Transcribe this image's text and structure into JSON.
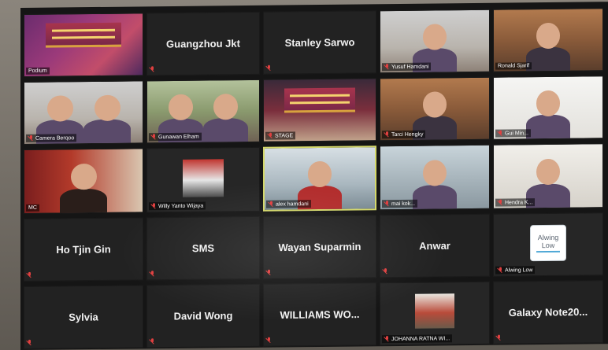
{
  "meeting": {
    "tiles": [
      {
        "name": "Podium",
        "type": "video",
        "scene": "podium"
      },
      {
        "name": "Guangzhou Jkt",
        "type": "name"
      },
      {
        "name": "Stanley Sarwo",
        "type": "name"
      },
      {
        "name": "Yusuf Hamdani",
        "type": "video",
        "scene": "room"
      },
      {
        "name": "Ronald Sjarif",
        "type": "video",
        "scene": "office"
      },
      {
        "name": "Camera Berqoo",
        "type": "video",
        "scene": "room"
      },
      {
        "name": "Gunawan Elham",
        "type": "video",
        "scene": "garden"
      },
      {
        "name": "STAGE",
        "type": "video",
        "scene": "stage"
      },
      {
        "name": "Tarci Hengky",
        "type": "video",
        "scene": "office"
      },
      {
        "name": "Gui Min...",
        "type": "video",
        "scene": "white"
      },
      {
        "name": "MC",
        "type": "video",
        "scene": "mc"
      },
      {
        "name": "Willy Yanto Wijaya",
        "type": "video",
        "scene": "dark"
      },
      {
        "name": "alex hamdani",
        "type": "video",
        "scene": "window",
        "active": true
      },
      {
        "name": "mai kok...",
        "type": "video",
        "scene": "car"
      },
      {
        "name": "Hendra K...",
        "type": "video",
        "scene": "light"
      },
      {
        "name": "Ho Tjin Gin",
        "type": "name"
      },
      {
        "name": "SMS",
        "type": "name"
      },
      {
        "name": "Wayan Suparmin",
        "type": "name"
      },
      {
        "name": "Anwar",
        "type": "name"
      },
      {
        "name": "Alwing Low",
        "type": "logo",
        "logo_text": [
          "Alwing",
          "Low"
        ]
      },
      {
        "name": "Sylvia",
        "type": "name"
      },
      {
        "name": "David Wong",
        "type": "name"
      },
      {
        "name": "WILLIAMS WO...",
        "type": "name"
      },
      {
        "name": "JOHANNA RATNA WI...",
        "type": "video",
        "scene": "pagoda"
      },
      {
        "name": "Galaxy Note20...",
        "type": "name"
      }
    ]
  },
  "colors": {
    "active_border": "#d4d86a",
    "muted_mic": "#e04040",
    "tile_bg": "#222222"
  }
}
